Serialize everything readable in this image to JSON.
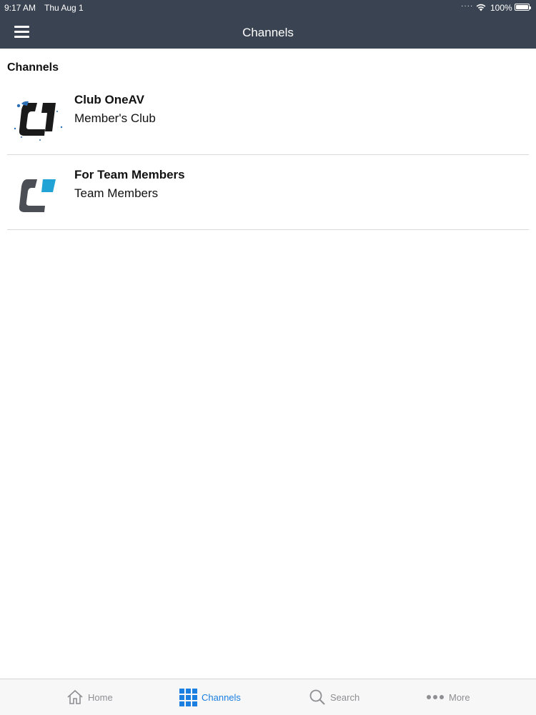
{
  "status_bar": {
    "time": "9:17 AM",
    "date": "Thu Aug 1",
    "battery": "100%"
  },
  "header": {
    "title": "Channels",
    "menu_icon": "hamburger-menu-icon"
  },
  "section": {
    "title": "Channels"
  },
  "channels": [
    {
      "title": "Club OneAV",
      "subtitle": "Member's Club",
      "logo": "oneav-club-logo",
      "accent": "#2b6fb6"
    },
    {
      "title": "For Team Members",
      "subtitle": "Team Members",
      "logo": "oneav-team-logo",
      "accent": "#21a3d6"
    }
  ],
  "tabbar": {
    "tabs": [
      {
        "label": "Home",
        "icon": "home-icon",
        "active": false
      },
      {
        "label": "Channels",
        "icon": "grid-icon",
        "active": true
      },
      {
        "label": "Search",
        "icon": "search-icon",
        "active": false
      },
      {
        "label": "More",
        "icon": "more-dots-icon",
        "active": false
      }
    ]
  },
  "colors": {
    "header_bg": "#3a4351",
    "active_tab": "#1a7fe1",
    "inactive_tab": "#8e8e93"
  }
}
